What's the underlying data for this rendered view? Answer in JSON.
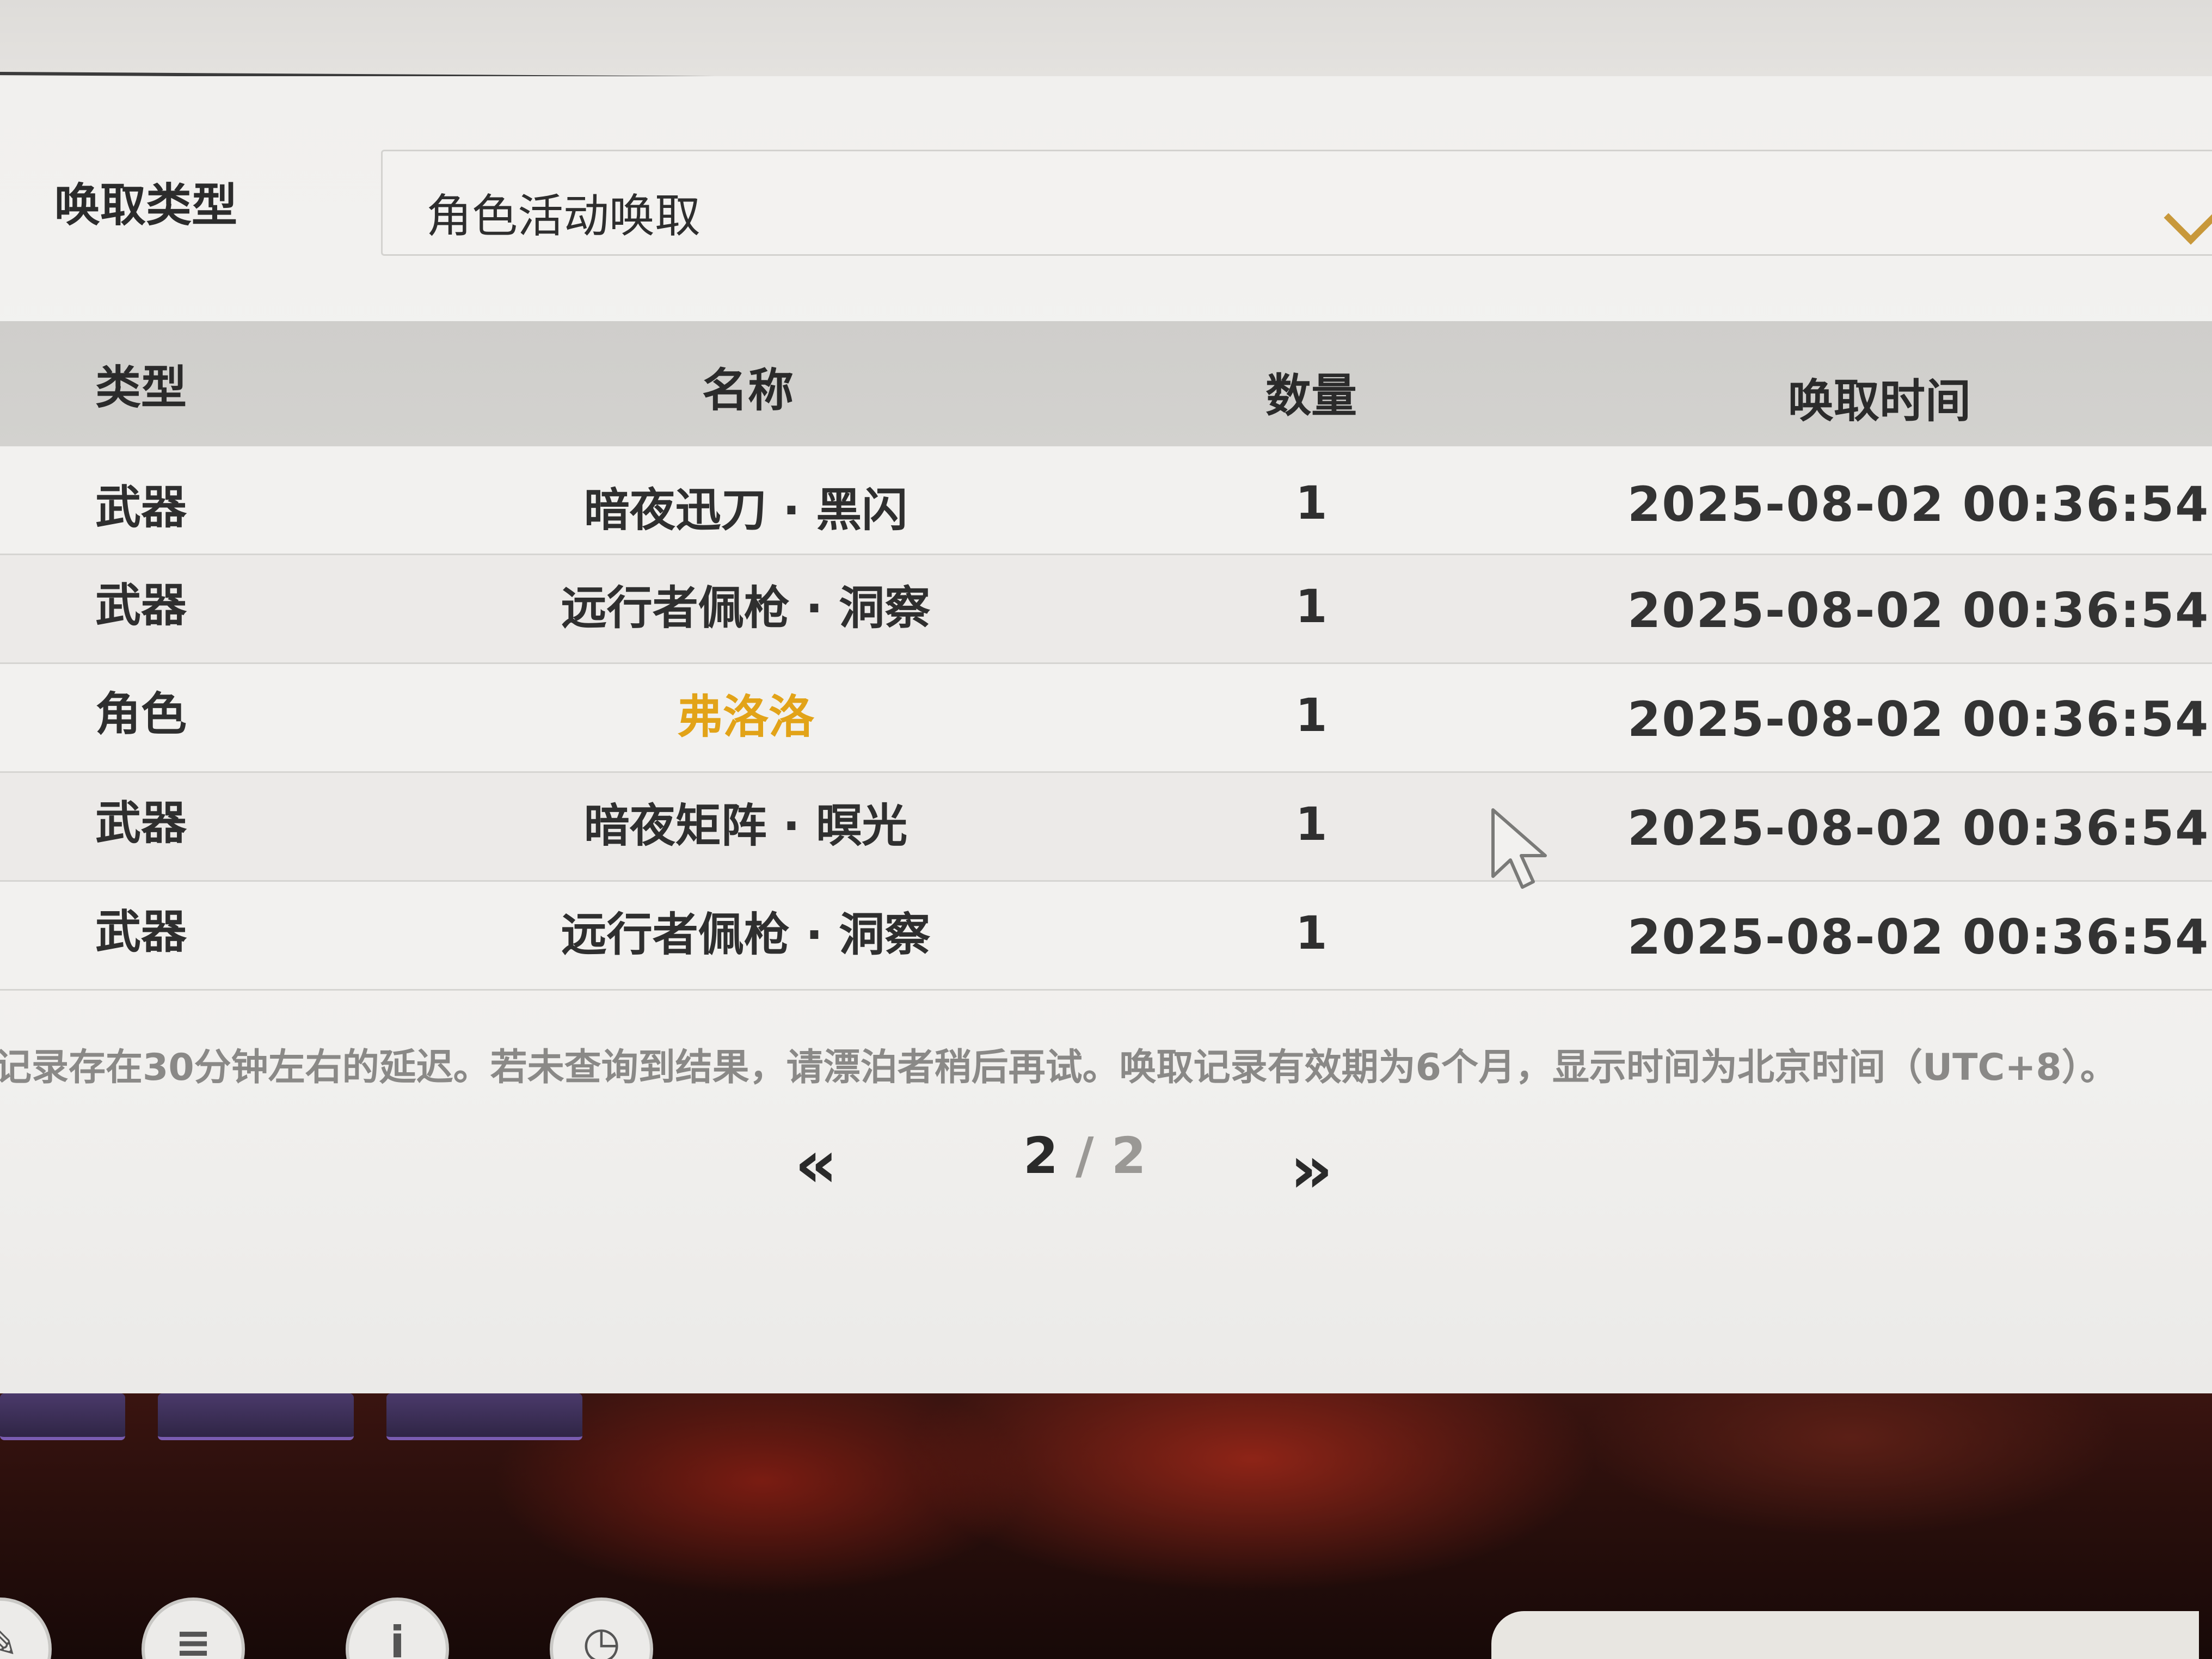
{
  "filter": {
    "label": "唤取类型",
    "selected": "角色活动唤取"
  },
  "table": {
    "headers": [
      "类型",
      "名称",
      "数量",
      "唤取时间"
    ],
    "rows": [
      {
        "type": "武器",
        "name": "暗夜迅刀 · 黑闪",
        "qty": "1",
        "time": "2025-08-02 00:36:54",
        "highlight": false
      },
      {
        "type": "武器",
        "name": "远行者佩枪 · 洞察",
        "qty": "1",
        "time": "2025-08-02 00:36:54",
        "highlight": false
      },
      {
        "type": "角色",
        "name": "弗洛洛",
        "qty": "1",
        "time": "2025-08-02 00:36:54",
        "highlight": true
      },
      {
        "type": "武器",
        "name": "暗夜矩阵 · 暝光",
        "qty": "1",
        "time": "2025-08-02 00:36:54",
        "highlight": false
      },
      {
        "type": "武器",
        "name": "远行者佩枪 · 洞察",
        "qty": "1",
        "time": "2025-08-02 00:36:54",
        "highlight": false
      }
    ]
  },
  "notice": "记录存在30分钟左右的延迟。若未查询到结果，请漂泊者稍后再试。唤取记录有效期为6个月，显示时间为北京时间（UTC+8）。",
  "pagination": {
    "prev": "‹‹",
    "next": "››",
    "current": "2",
    "separator": " / ",
    "total": "2"
  },
  "colors": {
    "accent": "#c8983a",
    "highlight_name": "#e2a318"
  },
  "icons": {
    "dropdown": "chevron-down-icon",
    "cursor": "mouse-pointer-icon"
  }
}
